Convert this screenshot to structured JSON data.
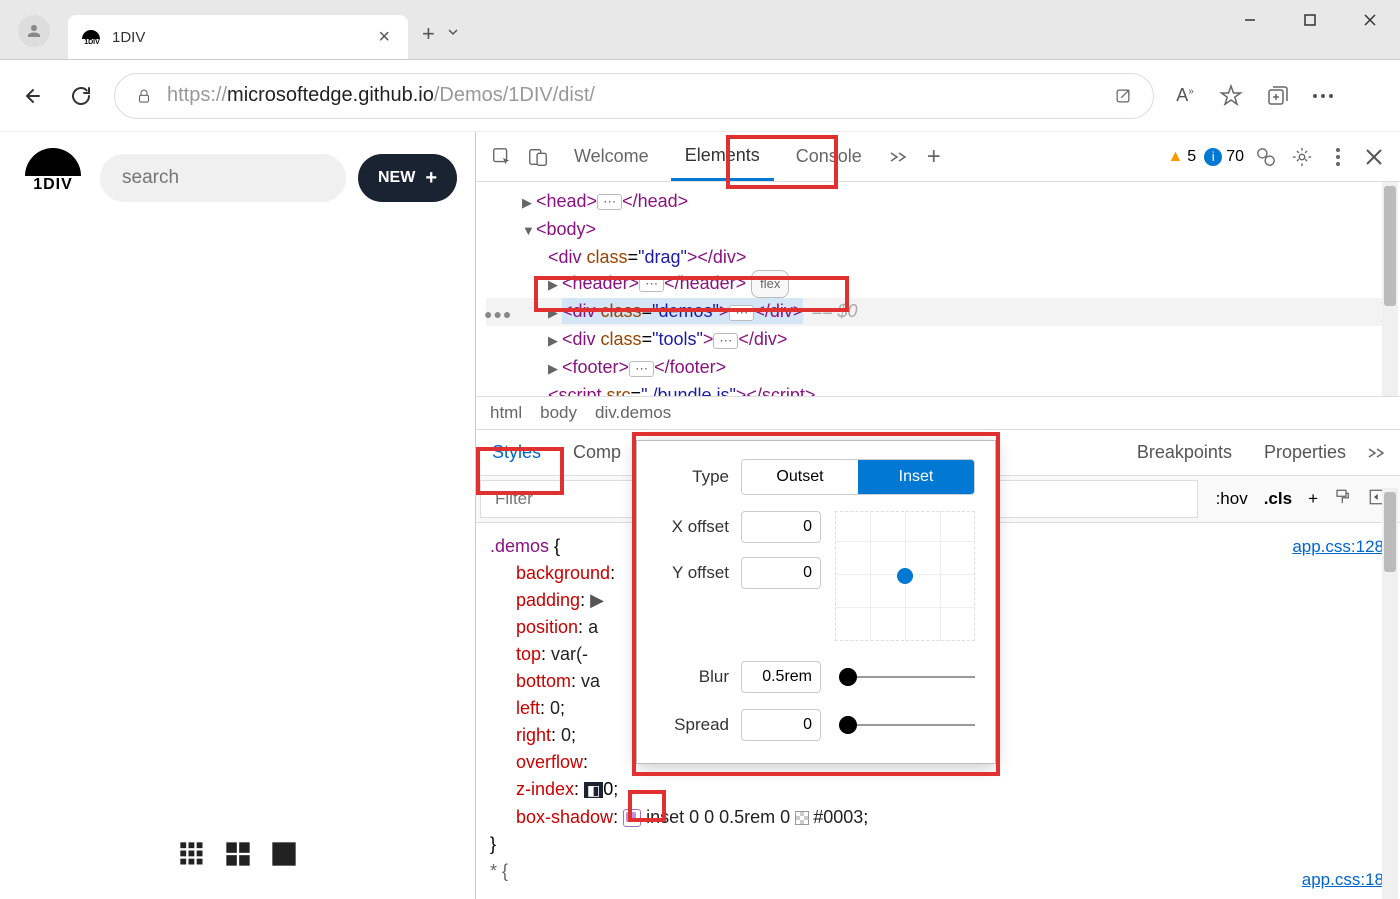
{
  "browser": {
    "tab_title": "1DIV",
    "url_host": "microsoftedge.github.io",
    "url_prefix": "https://",
    "url_path": "/Demos/1DIV/dist/"
  },
  "page": {
    "logo_text": "1DIV",
    "search_placeholder": "search",
    "new_button": "NEW"
  },
  "devtools": {
    "tabs": {
      "welcome": "Welcome",
      "elements": "Elements",
      "console": "Console"
    },
    "warn_count": "5",
    "info_count": "70",
    "breadcrumb": [
      "html",
      "body",
      "div.demos"
    ],
    "styles_tabs": {
      "styles": "Styles",
      "computed": "Comp",
      "breakpoints": "Breakpoints",
      "properties": "Properties"
    },
    "filter_placeholder": "Filter",
    "hov": ":hov",
    "cls": ".cls",
    "css": {
      "selector": ".demos",
      "source": "app.css:128",
      "source2": "app.css:18",
      "props": {
        "background": "background",
        "padding": "padding",
        "position": "position",
        "position_val": "a",
        "top": "top",
        "top_val": "var(-",
        "bottom": "bottom",
        "bottom_val": "va",
        "left": "left",
        "left_val": "0",
        "right": "right",
        "right_val": "0",
        "overflow": "overflow",
        "zindex": "z-index",
        "boxshadow": "box-shadow",
        "boxshadow_val": "inset 0 0 0.5rem 0 ",
        "boxshadow_color": "#0003"
      }
    }
  },
  "shadow_editor": {
    "type_label": "Type",
    "outset": "Outset",
    "inset": "Inset",
    "x_label": "X offset",
    "x_val": "0",
    "y_label": "Y offset",
    "y_val": "0",
    "blur_label": "Blur",
    "blur_val": "0.5rem",
    "spread_label": "Spread",
    "spread_val": "0"
  }
}
